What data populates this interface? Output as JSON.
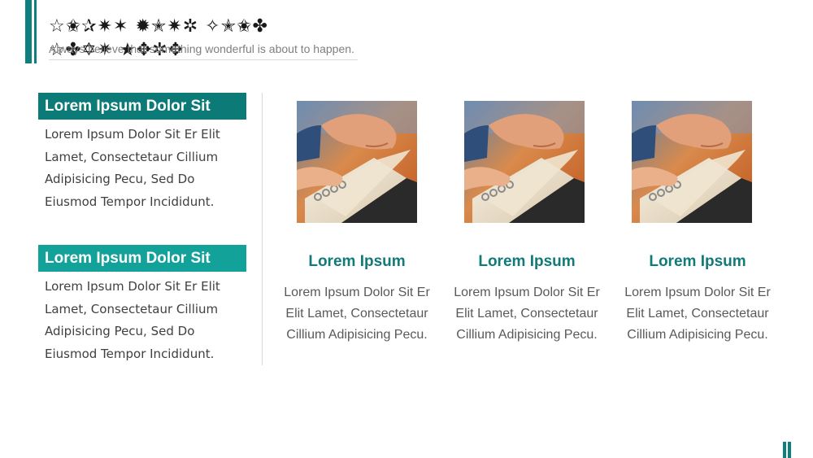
{
  "header": {
    "title_glyphs": "☆✬✰✷✶ ✹✭✷✲ ✧✭✬✤ ☆✤✡✷ ★✥✲✥",
    "subtitle": "Always believe that something wonderful is about to happen."
  },
  "sections": [
    {
      "heading": "Lorem Ipsum Dolor Sit",
      "body": "Lorem Ipsum Dolor Sit Er Elit Lamet, Consectetaur Cillium Adipisicing Pecu, Sed Do Eiusmod Tempor Incididunt."
    },
    {
      "heading": "Lorem Ipsum Dolor Sit",
      "body": "Lorem Ipsum Dolor Sit Er Elit Lamet, Consectetaur Cillium Adipisicing Pecu, Sed Do Eiusmod Tempor Incididunt."
    }
  ],
  "cards": [
    {
      "title": "Lorem Ipsum",
      "text": "Lorem Ipsum Dolor Sit Er Elit Lamet, Consectetaur Cillium Adipisicing Pecu."
    },
    {
      "title": "Lorem Ipsum",
      "text": "Lorem Ipsum Dolor Sit Er Elit Lamet, Consectetaur Cillium Adipisicing Pecu."
    },
    {
      "title": "Lorem Ipsum",
      "text": "Lorem Ipsum Dolor Sit Er Elit Lamet, Consectetaur Cillium Adipisicing Pecu."
    }
  ],
  "colors": {
    "accent_dark": "#0c7b78",
    "accent_light": "#13a29a",
    "card_title": "#127a78"
  }
}
